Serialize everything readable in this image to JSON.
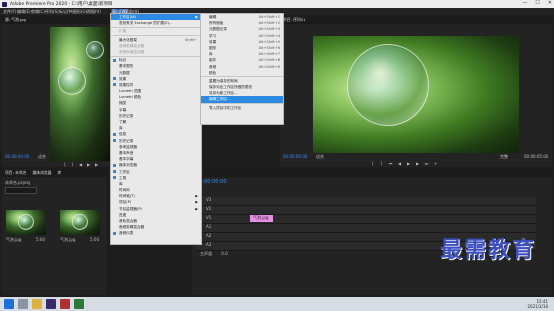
{
  "window": {
    "title": "Adobe Premiere Pro 2020 - C:\\用户\\桌面\\新项目",
    "minimize": "—",
    "maximize": "☐",
    "close": "✕"
  },
  "menubar": [
    "文件(F)",
    "编辑(E)",
    "剪辑(C)",
    "序列(S)",
    "标记(M)",
    "图形(G)",
    "视图(V)",
    "窗口(W)",
    "帮助(H)"
  ],
  "source_panel": {
    "tab": "源: 气泡.jpg",
    "timecode_left": "00:00:00:00",
    "fit": "适合",
    "timecode_right": "00:00:05:00"
  },
  "program_panel": {
    "tab": "节目: 序列01",
    "timecode_left": "00:00:00:00",
    "fit": "适合",
    "full": "完整",
    "timecode_right": "00:00:05:00"
  },
  "project_panel": {
    "tabs": [
      "项目: 未命名",
      "媒体浏览器",
      "库"
    ],
    "file": "未命名.prproj",
    "items": [
      "气泡.jpg",
      "气泡.jpg"
    ],
    "durations": [
      "5:00",
      "5:00"
    ]
  },
  "timeline": {
    "timecode": "00:00:00:00",
    "clip": "气泡.jpg",
    "tracks": [
      "V3",
      "V2",
      "V1",
      "A1",
      "A2",
      "A3"
    ],
    "master": "主声道",
    "master_value": "0.0"
  },
  "window_menu": {
    "items": [
      {
        "label": "工作区(W)",
        "arrow": true,
        "hl": true
      },
      {
        "label": "查找有关 Exchange 的扩展(E)...",
        "dis": false
      },
      {
        "sep": true
      },
      {
        "label": "扩展",
        "dis": true
      },
      {
        "sep": true
      },
      {
        "label": "最大化框架",
        "sc": "Shift+`"
      },
      {
        "label": "音频剪辑混合器",
        "dis": true
      },
      {
        "label": "音频轨道混合器",
        "dis": true
      },
      {
        "sep": true
      },
      {
        "label": "标记",
        "chk": true
      },
      {
        "label": "基本图形"
      },
      {
        "label": "元数据"
      },
      {
        "label": "效果",
        "chk": true
      },
      {
        "label": "效果控件",
        "chk": true
      },
      {
        "label": "Lumetri 范围"
      },
      {
        "label": "Lumetri 颜色"
      },
      {
        "label": "捕捉"
      },
      {
        "label": "字幕"
      },
      {
        "label": "历史记录"
      },
      {
        "label": "了解"
      },
      {
        "label": "库"
      },
      {
        "label": "信息",
        "chk": true
      },
      {
        "label": "历史记录",
        "chk": true
      },
      {
        "label": "参考监视器"
      },
      {
        "label": "基本声音"
      },
      {
        "label": "基本字幕"
      },
      {
        "label": "媒体浏览器",
        "chk": true
      },
      {
        "label": "工作区",
        "chk": true
      },
      {
        "label": "工具",
        "chk": true
      },
      {
        "label": "库"
      },
      {
        "label": "时间码"
      },
      {
        "label": "时间轴(T)",
        "arrow": true
      },
      {
        "label": "项目(P)",
        "arrow": true
      },
      {
        "label": "节目监视器(P)",
        "arrow": true
      },
      {
        "label": "进度"
      },
      {
        "label": "音轨混合器"
      },
      {
        "label": "音频剪辑混合器"
      },
      {
        "label": "音频仪表",
        "chk": true
      }
    ]
  },
  "workspace_submenu": {
    "items": [
      {
        "label": "编辑",
        "sc": "Alt+Shift+1"
      },
      {
        "label": "所有面板",
        "sc": "Alt+Shift+2"
      },
      {
        "label": "元数据记录",
        "sc": "Alt+Shift+3"
      },
      {
        "label": "学习",
        "sc": "Alt+Shift+4"
      },
      {
        "label": "效果",
        "sc": "Alt+Shift+5"
      },
      {
        "label": "图形",
        "sc": "Alt+Shift+6"
      },
      {
        "label": "库",
        "sc": "Alt+Shift+7"
      },
      {
        "label": "组件",
        "sc": "Alt+Shift+8"
      },
      {
        "label": "音频",
        "sc": "Alt+Shift+9"
      },
      {
        "label": "颜色"
      },
      {
        "sep": true
      },
      {
        "label": "重置为保存的布局"
      },
      {
        "label": "保存对此工作区所做的更改"
      },
      {
        "label": "另存为新工作区..."
      },
      {
        "label": "编辑工作区...",
        "hl": true
      },
      {
        "sep": true
      },
      {
        "label": "导入项目中的工作区"
      }
    ]
  },
  "watermark": "最需教育",
  "taskbar": {
    "time": "15:41",
    "date": "2021/3/10"
  }
}
